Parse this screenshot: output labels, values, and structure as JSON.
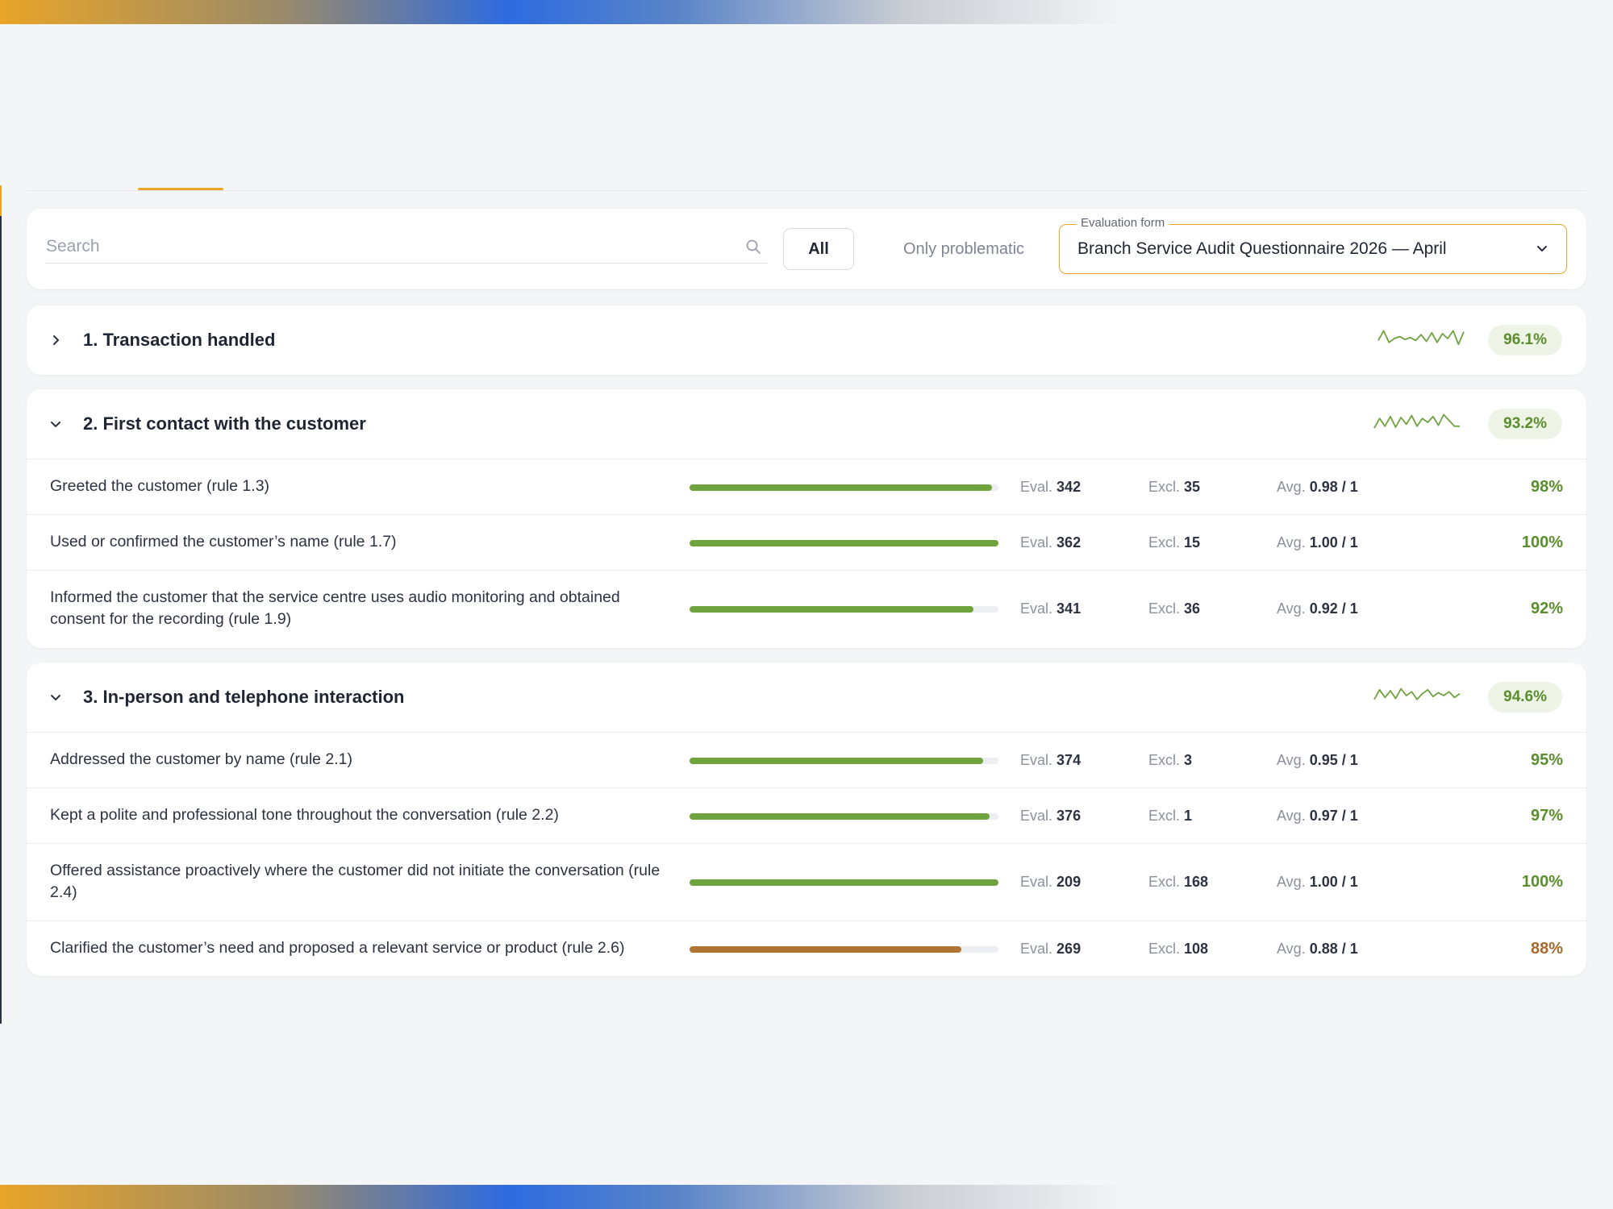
{
  "search": {
    "placeholder": "Search"
  },
  "filters": {
    "all_label": "All",
    "problematic_label": "Only problematic"
  },
  "evaluation_form": {
    "legend": "Evaluation form",
    "selected": "Branch Service Audit Questionnaire 2026 — April"
  },
  "stat_labels": {
    "eval": "Eval.",
    "excl": "Excl.",
    "avg": "Avg."
  },
  "colors": {
    "accent": "#e8a528",
    "good": "#6ea33d",
    "warn": "#b07432",
    "badge_bg": "#edf3e5"
  },
  "sections": [
    {
      "title": "1. Transaction handled",
      "expanded": false,
      "score": "96.1%",
      "trend": [
        0.4,
        0.9,
        0.3,
        0.5,
        0.6,
        0.45,
        0.55,
        0.4,
        0.7,
        0.35,
        0.8,
        0.3,
        0.75,
        0.5,
        0.9,
        0.2,
        0.85
      ]
    },
    {
      "title": "2. First contact with the customer",
      "expanded": true,
      "score": "93.2%",
      "trend": [
        0.2,
        0.7,
        0.3,
        0.8,
        0.25,
        0.75,
        0.4,
        0.85,
        0.3,
        0.7,
        0.5,
        0.8,
        0.35,
        0.9,
        0.6,
        0.3,
        0.3
      ],
      "rules": [
        {
          "label": "Greeted the customer (rule 1.3)",
          "progress": 0.98,
          "eval": "342",
          "excl": "35",
          "avg": "0.98 / 1",
          "pct": "98%",
          "status": "good"
        },
        {
          "label": "Used or confirmed the customer’s name (rule 1.7)",
          "progress": 1.0,
          "eval": "362",
          "excl": "15",
          "avg": "1.00 / 1",
          "pct": "100%",
          "status": "good"
        },
        {
          "label": "Informed the customer that the service centre uses audio monitoring and obtained consent for the recording (rule 1.9)",
          "progress": 0.92,
          "eval": "341",
          "excl": "36",
          "avg": "0.92 / 1",
          "pct": "92%",
          "status": "good"
        }
      ]
    },
    {
      "title": "3. In-person and telephone interaction",
      "expanded": true,
      "score": "94.6%",
      "trend": [
        0.3,
        0.8,
        0.4,
        0.75,
        0.35,
        0.85,
        0.5,
        0.7,
        0.3,
        0.6,
        0.8,
        0.45,
        0.65,
        0.5,
        0.7,
        0.4,
        0.6
      ],
      "rules": [
        {
          "label": "Addressed the customer by name (rule 2.1)",
          "progress": 0.95,
          "eval": "374",
          "excl": "3",
          "avg": "0.95 / 1",
          "pct": "95%",
          "status": "good"
        },
        {
          "label": "Kept a polite and professional tone throughout the conversation (rule 2.2)",
          "progress": 0.97,
          "eval": "376",
          "excl": "1",
          "avg": "0.97 / 1",
          "pct": "97%",
          "status": "good"
        },
        {
          "label": "Offered assistance proactively where the customer did not initiate the conversation (rule 2.4)",
          "progress": 1.0,
          "eval": "209",
          "excl": "168",
          "avg": "1.00 / 1",
          "pct": "100%",
          "status": "good"
        },
        {
          "label": "Clarified the customer’s need and proposed a relevant service or product (rule 2.6)",
          "progress": 0.88,
          "eval": "269",
          "excl": "108",
          "avg": "0.88 / 1",
          "pct": "88%",
          "status": "warn"
        }
      ]
    }
  ]
}
